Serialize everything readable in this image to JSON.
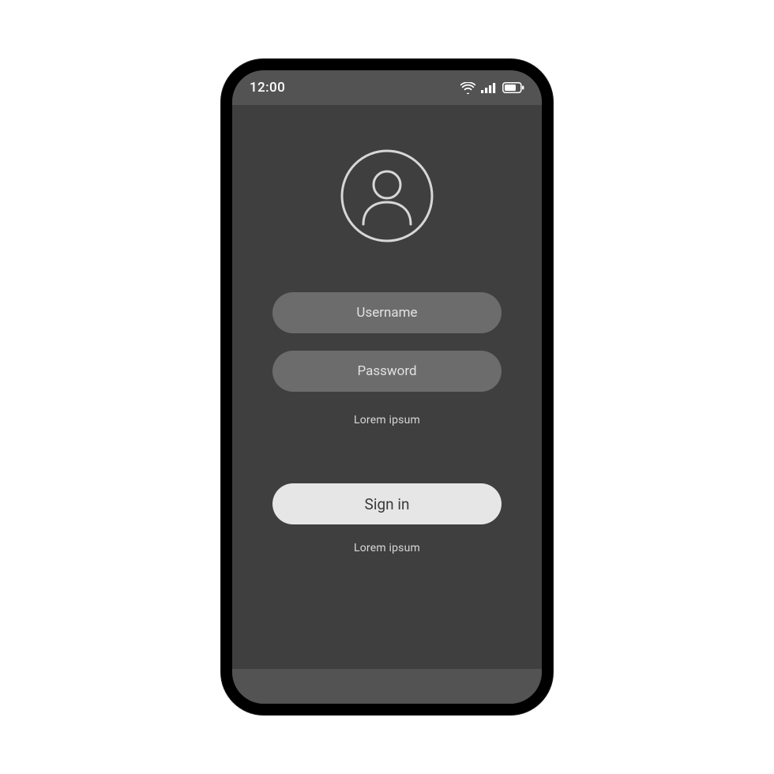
{
  "status": {
    "time": "12:00"
  },
  "login": {
    "username_placeholder": "Username",
    "password_placeholder": "Password",
    "helper_1": "Lorem ipsum",
    "signin_label": "Sign in",
    "helper_2": "Lorem ipsum"
  }
}
